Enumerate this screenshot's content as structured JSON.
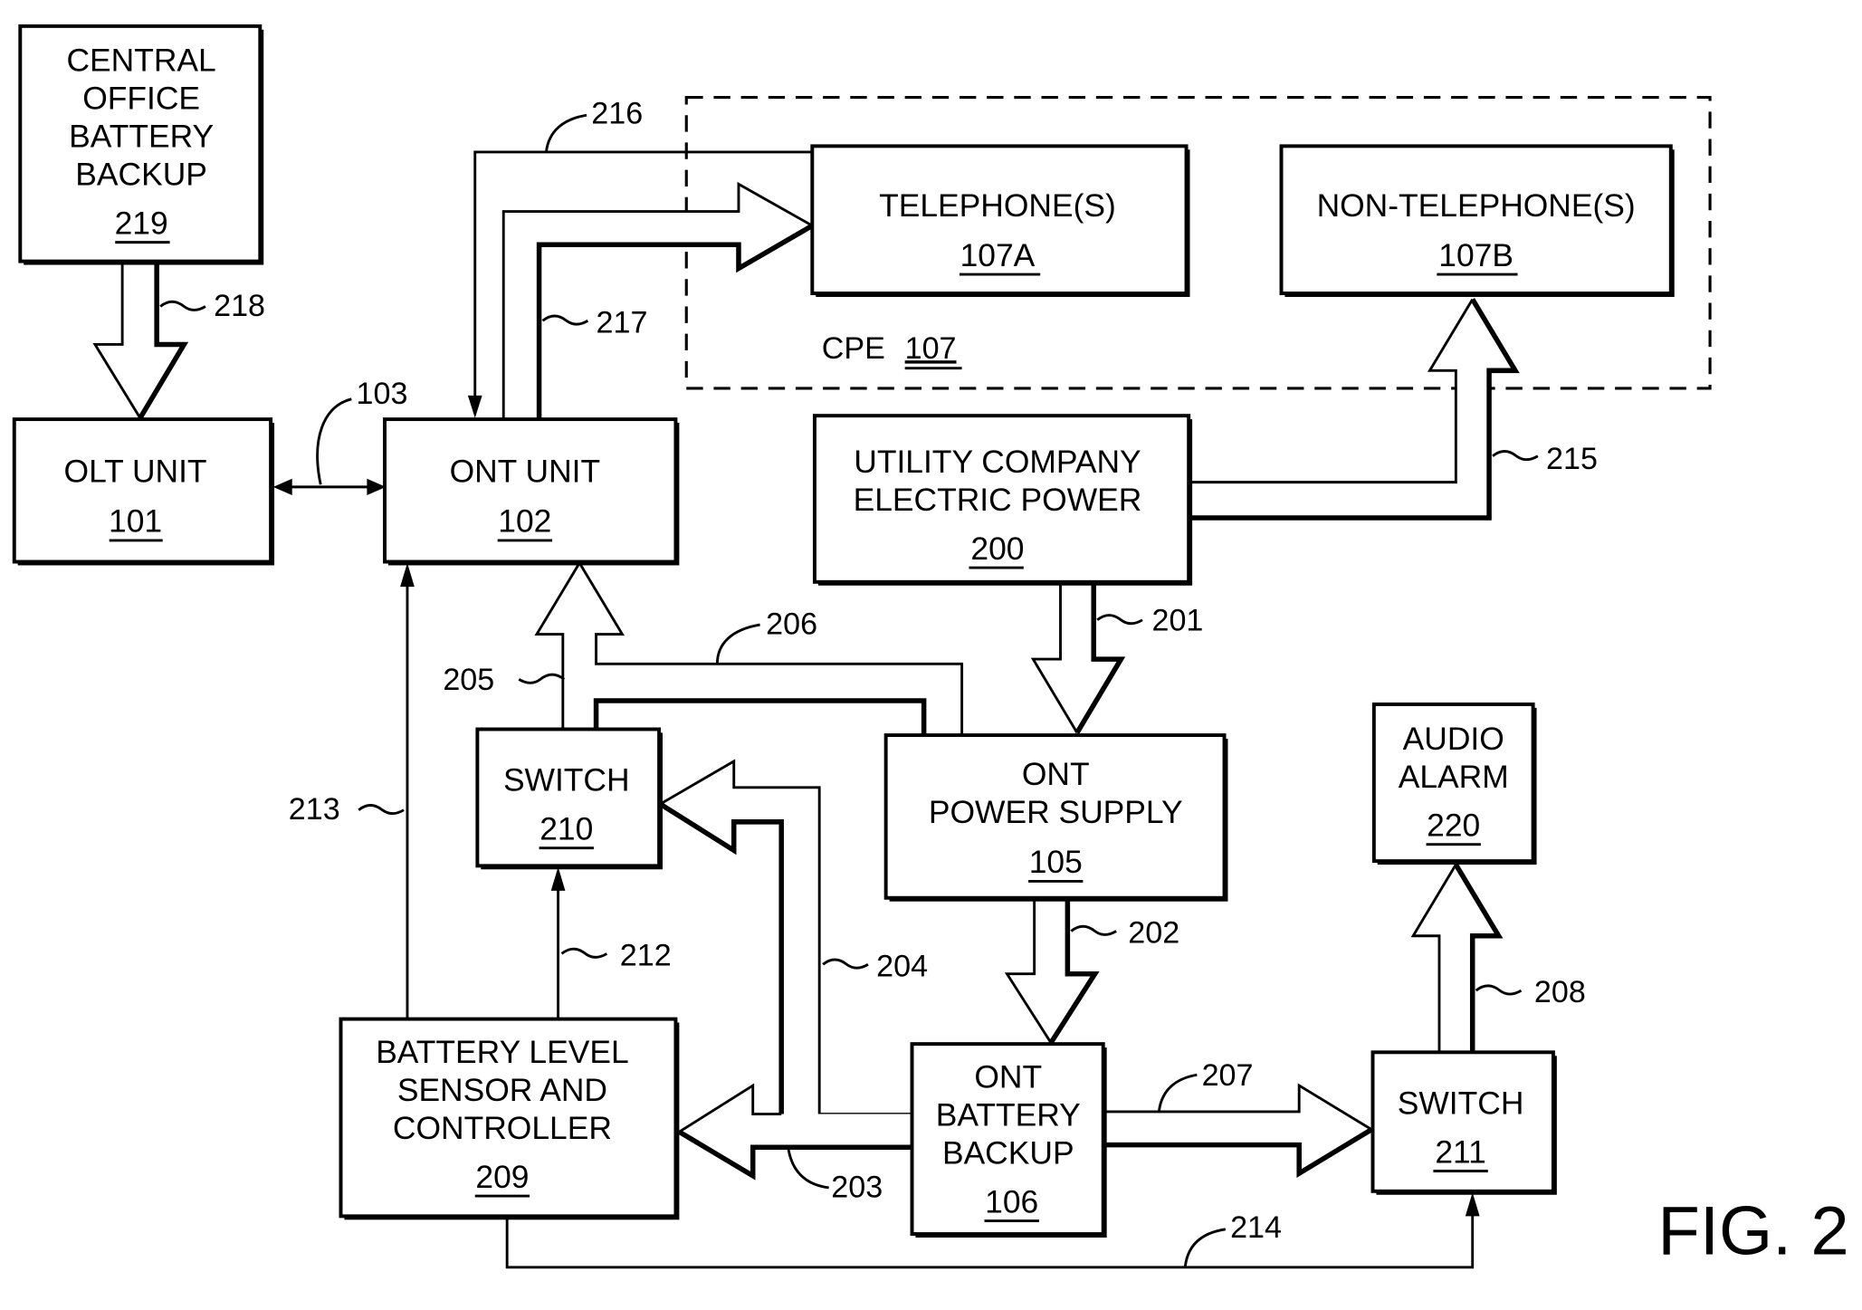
{
  "figure": {
    "title": "FIG. 2",
    "cpe_group": {
      "label": "CPE",
      "ref": "107"
    },
    "blocks": [
      {
        "id": "central-office-battery-backup",
        "lines": [
          "CENTRAL",
          "OFFICE",
          "BATTERY",
          "BACKUP"
        ],
        "ref": "219"
      },
      {
        "id": "olt-unit",
        "lines": [
          "OLT UNIT"
        ],
        "ref": "101"
      },
      {
        "id": "ont-unit",
        "lines": [
          "ONT UNIT"
        ],
        "ref": "102"
      },
      {
        "id": "telephones",
        "lines": [
          "TELEPHONE(S)"
        ],
        "ref": "107A"
      },
      {
        "id": "non-telephones",
        "lines": [
          "NON-TELEPHONE(S)"
        ],
        "ref": "107B"
      },
      {
        "id": "utility-company-electric-power",
        "lines": [
          "UTILITY COMPANY",
          "ELECTRIC POWER"
        ],
        "ref": "200"
      },
      {
        "id": "switch-210",
        "lines": [
          "SWITCH"
        ],
        "ref": "210"
      },
      {
        "id": "ont-power-supply",
        "lines": [
          "ONT",
          "POWER SUPPLY"
        ],
        "ref": "105"
      },
      {
        "id": "audio-alarm",
        "lines": [
          "AUDIO",
          "ALARM"
        ],
        "ref": "220"
      },
      {
        "id": "battery-level-sensor-controller",
        "lines": [
          "BATTERY LEVEL",
          "SENSOR AND",
          "CONTROLLER"
        ],
        "ref": "209"
      },
      {
        "id": "ont-battery-backup",
        "lines": [
          "ONT",
          "BATTERY",
          "BACKUP"
        ],
        "ref": "106"
      },
      {
        "id": "switch-211",
        "lines": [
          "SWITCH"
        ],
        "ref": "211"
      }
    ],
    "connection_refs": {
      "r103": "103",
      "r201": "201",
      "r202": "202",
      "r203": "203",
      "r204": "204",
      "r205": "205",
      "r206": "206",
      "r207": "207",
      "r208": "208",
      "r212": "212",
      "r213": "213",
      "r214": "214",
      "r215": "215",
      "r216": "216",
      "r217": "217",
      "r218": "218"
    }
  }
}
